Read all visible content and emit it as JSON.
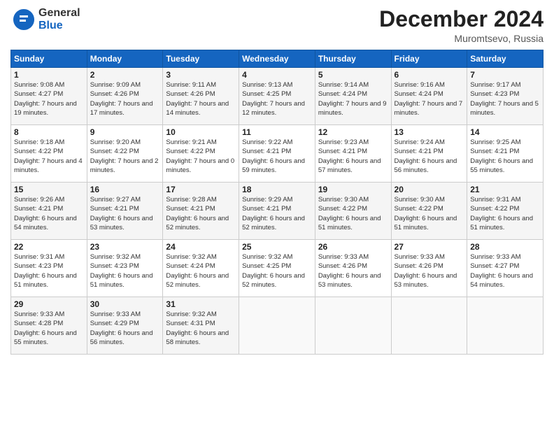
{
  "header": {
    "logo_line1": "General",
    "logo_line2": "Blue",
    "month": "December 2024",
    "location": "Muromtsevo, Russia"
  },
  "weekdays": [
    "Sunday",
    "Monday",
    "Tuesday",
    "Wednesday",
    "Thursday",
    "Friday",
    "Saturday"
  ],
  "weeks": [
    [
      {
        "day": "1",
        "sunrise": "9:08 AM",
        "sunset": "4:27 PM",
        "daylight": "7 hours and 19 minutes."
      },
      {
        "day": "2",
        "sunrise": "9:09 AM",
        "sunset": "4:26 PM",
        "daylight": "7 hours and 17 minutes."
      },
      {
        "day": "3",
        "sunrise": "9:11 AM",
        "sunset": "4:26 PM",
        "daylight": "7 hours and 14 minutes."
      },
      {
        "day": "4",
        "sunrise": "9:13 AM",
        "sunset": "4:25 PM",
        "daylight": "7 hours and 12 minutes."
      },
      {
        "day": "5",
        "sunrise": "9:14 AM",
        "sunset": "4:24 PM",
        "daylight": "7 hours and 9 minutes."
      },
      {
        "day": "6",
        "sunrise": "9:16 AM",
        "sunset": "4:24 PM",
        "daylight": "7 hours and 7 minutes."
      },
      {
        "day": "7",
        "sunrise": "9:17 AM",
        "sunset": "4:23 PM",
        "daylight": "7 hours and 5 minutes."
      }
    ],
    [
      {
        "day": "8",
        "sunrise": "9:18 AM",
        "sunset": "4:22 PM",
        "daylight": "7 hours and 4 minutes."
      },
      {
        "day": "9",
        "sunrise": "9:20 AM",
        "sunset": "4:22 PM",
        "daylight": "7 hours and 2 minutes."
      },
      {
        "day": "10",
        "sunrise": "9:21 AM",
        "sunset": "4:22 PM",
        "daylight": "7 hours and 0 minutes."
      },
      {
        "day": "11",
        "sunrise": "9:22 AM",
        "sunset": "4:21 PM",
        "daylight": "6 hours and 59 minutes."
      },
      {
        "day": "12",
        "sunrise": "9:23 AM",
        "sunset": "4:21 PM",
        "daylight": "6 hours and 57 minutes."
      },
      {
        "day": "13",
        "sunrise": "9:24 AM",
        "sunset": "4:21 PM",
        "daylight": "6 hours and 56 minutes."
      },
      {
        "day": "14",
        "sunrise": "9:25 AM",
        "sunset": "4:21 PM",
        "daylight": "6 hours and 55 minutes."
      }
    ],
    [
      {
        "day": "15",
        "sunrise": "9:26 AM",
        "sunset": "4:21 PM",
        "daylight": "6 hours and 54 minutes."
      },
      {
        "day": "16",
        "sunrise": "9:27 AM",
        "sunset": "4:21 PM",
        "daylight": "6 hours and 53 minutes."
      },
      {
        "day": "17",
        "sunrise": "9:28 AM",
        "sunset": "4:21 PM",
        "daylight": "6 hours and 52 minutes."
      },
      {
        "day": "18",
        "sunrise": "9:29 AM",
        "sunset": "4:21 PM",
        "daylight": "6 hours and 52 minutes."
      },
      {
        "day": "19",
        "sunrise": "9:30 AM",
        "sunset": "4:22 PM",
        "daylight": "6 hours and 51 minutes."
      },
      {
        "day": "20",
        "sunrise": "9:30 AM",
        "sunset": "4:22 PM",
        "daylight": "6 hours and 51 minutes."
      },
      {
        "day": "21",
        "sunrise": "9:31 AM",
        "sunset": "4:22 PM",
        "daylight": "6 hours and 51 minutes."
      }
    ],
    [
      {
        "day": "22",
        "sunrise": "9:31 AM",
        "sunset": "4:23 PM",
        "daylight": "6 hours and 51 minutes."
      },
      {
        "day": "23",
        "sunrise": "9:32 AM",
        "sunset": "4:23 PM",
        "daylight": "6 hours and 51 minutes."
      },
      {
        "day": "24",
        "sunrise": "9:32 AM",
        "sunset": "4:24 PM",
        "daylight": "6 hours and 52 minutes."
      },
      {
        "day": "25",
        "sunrise": "9:32 AM",
        "sunset": "4:25 PM",
        "daylight": "6 hours and 52 minutes."
      },
      {
        "day": "26",
        "sunrise": "9:33 AM",
        "sunset": "4:26 PM",
        "daylight": "6 hours and 53 minutes."
      },
      {
        "day": "27",
        "sunrise": "9:33 AM",
        "sunset": "4:26 PM",
        "daylight": "6 hours and 53 minutes."
      },
      {
        "day": "28",
        "sunrise": "9:33 AM",
        "sunset": "4:27 PM",
        "daylight": "6 hours and 54 minutes."
      }
    ],
    [
      {
        "day": "29",
        "sunrise": "9:33 AM",
        "sunset": "4:28 PM",
        "daylight": "6 hours and 55 minutes."
      },
      {
        "day": "30",
        "sunrise": "9:33 AM",
        "sunset": "4:29 PM",
        "daylight": "6 hours and 56 minutes."
      },
      {
        "day": "31",
        "sunrise": "9:32 AM",
        "sunset": "4:31 PM",
        "daylight": "6 hours and 58 minutes."
      },
      null,
      null,
      null,
      null
    ]
  ]
}
